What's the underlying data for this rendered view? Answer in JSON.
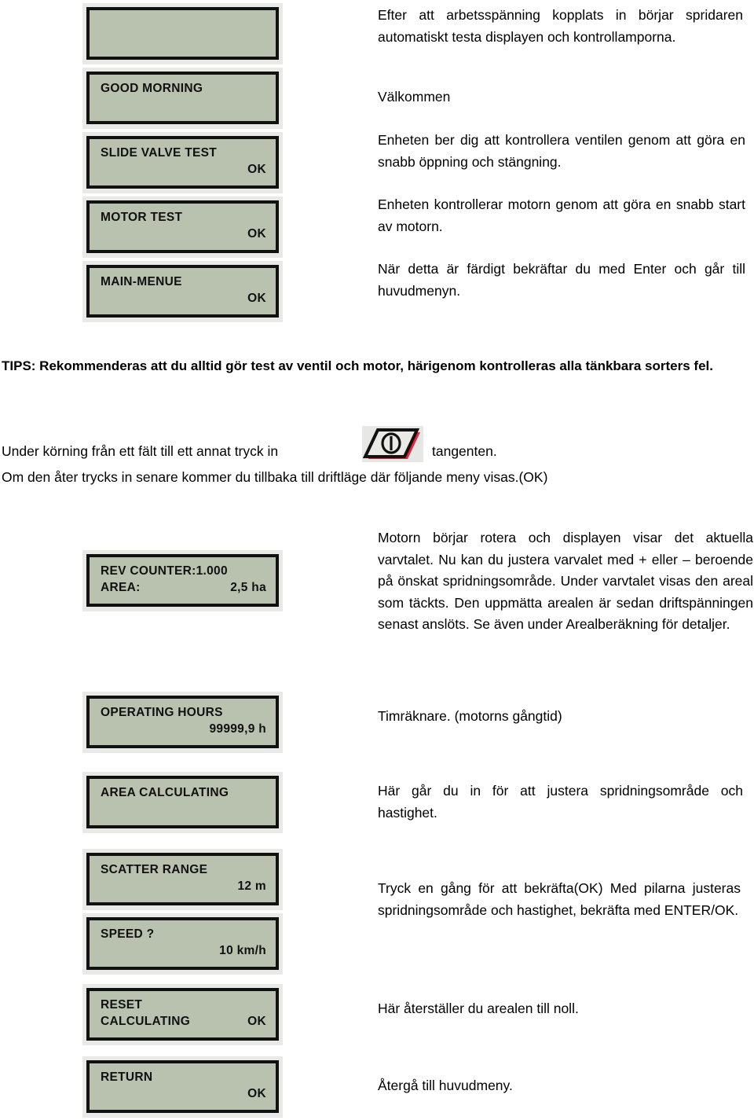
{
  "document": {
    "language": "sv",
    "lcd_colors": {
      "screen": "#b9c1af",
      "bezel": "#111111",
      "outer": "#e9eae6"
    },
    "accent_red": "#e8283c"
  },
  "top_displays": [
    {
      "name": "blank-display",
      "line1": "",
      "line1_right": "",
      "line2": "",
      "line2_right": ""
    },
    {
      "name": "good-morning-display",
      "line1": "GOOD MORNING",
      "line1_right": "",
      "line2": "",
      "line2_right": ""
    },
    {
      "name": "slide-valve-test-display",
      "line1": "SLIDE VALVE TEST",
      "line1_right": "",
      "line2": "",
      "line2_right": "OK"
    },
    {
      "name": "motor-test-display",
      "line1": "MOTOR TEST",
      "line1_right": "",
      "line2": "",
      "line2_right": "OK"
    },
    {
      "name": "main-menue-display",
      "line1": "MAIN-MENUE",
      "line1_right": "",
      "line2": "",
      "line2_right": "OK"
    }
  ],
  "bottom_displays": [
    {
      "name": "rev-counter-display",
      "line1": "REV COUNTER:1.000",
      "line1_right": "",
      "line2": "AREA:",
      "line2_right": "2,5 ha"
    },
    {
      "name": "operating-hours-display",
      "line1": "OPERATING HOURS",
      "line1_right": "",
      "line2": "",
      "line2_right": "99999,9 h"
    },
    {
      "name": "area-calculating-display",
      "line1": "AREA CALCULATING",
      "line1_right": "",
      "line2": "",
      "line2_right": ""
    },
    {
      "name": "scatter-range-display",
      "line1": "SCATTER RANGE",
      "line1_right": "",
      "line2": "",
      "line2_right": "12 m"
    },
    {
      "name": "speed-display",
      "line1": "SPEED ?",
      "line1_right": "",
      "line2": "",
      "line2_right": "10 km/h"
    },
    {
      "name": "reset-calculating-display",
      "line1": "RESET",
      "line1_right": "",
      "line2": "CALCULATING",
      "line2_right": "OK"
    },
    {
      "name": "return-display",
      "line1": "RETURN",
      "line1_right": "",
      "line2": "",
      "line2_right": "OK"
    }
  ],
  "text": {
    "intro": "Efter att arbetsspänning kopplats in börjar spridaren automatiskt testa displayen och kontrollamporna.",
    "welcome": "Välkommen",
    "valve_check": "Enheten ber dig att kontrollera ventilen genom att göra en snabb öppning och stängning.",
    "motor_check": "Enheten kontrollerar motorn genom att göra en snabb start av motorn.",
    "confirm_enter": "När detta är färdigt bekräftar du med Enter och går till huvudmenyn.",
    "tips": "TIPS:  Rekommenderas att du alltid gör test av ventil och motor, härigenom kontrolleras alla tänkbara sorters fel.",
    "field_switch_before": "Under körning från ett fält till ett annat tryck in",
    "field_switch_after": "tangenten.",
    "field_switch_line2": "Om den åter trycks in senare kommer du tillbaka till driftläge där följande meny visas.(OK)",
    "motor_rotation": "Motorn börjar rotera och displayen visar det aktuella varvtalet. Nu kan du justera varvalet med + eller – beroende på önskat spridningsområde. Under varvtalet visas den areal som täckts. Den uppmätta arealen är sedan driftspänningen senast anslöts. Se även under Arealberäkning för detaljer.",
    "hour_counter": "Timräknare.  (motorns gångtid)",
    "adjust_here": "Här går du in för att justera spridningsområde och hastighet.",
    "confirm_arrows": "Tryck en gång för att bekräfta(OK) Med pilarna justeras spridningsområde och hastighet, bekräfta med ENTER/OK.",
    "reset_area": "Här återställer du arealen till noll.",
    "return_main": "Återgå till huvudmeny."
  },
  "icons": {
    "power_key": "power-key-icon"
  }
}
